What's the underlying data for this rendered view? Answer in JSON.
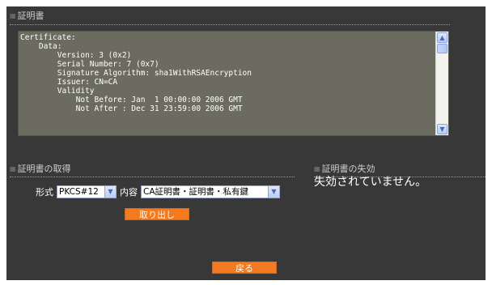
{
  "certificate_section": {
    "title": "証明書",
    "content": "Certificate:\n    Data:\n        Version: 3 (0x2)\n        Serial Number: 7 (0x7)\n        Signature Algorithm: sha1WithRSAEncryption\n        Issuer: CN=CA\n        Validity\n            Not Before: Jan  1 00:00:00 2006 GMT\n            Not After : Dec 31 23:59:00 2006 GMT"
  },
  "retrieve_section": {
    "title": "証明書の取得",
    "format_label": "形式",
    "format_value": "PKCS#12",
    "content_label": "内容",
    "content_value": "CA証明書・証明書・私有鍵",
    "extract_button": "取り出し"
  },
  "revocation_section": {
    "title": "証明書の失効",
    "status": "失効されていません。"
  },
  "back_button": "戻る",
  "colors": {
    "panel_bg": "#383838",
    "textarea_bg": "#6b6b5f",
    "button_orange": "#f47a20"
  },
  "icons": {
    "section_marker": "dotted-grid-icon",
    "scroll_up": "chevron-up-icon",
    "scroll_down": "chevron-down-icon",
    "select_arrow": "chevron-down-icon"
  }
}
